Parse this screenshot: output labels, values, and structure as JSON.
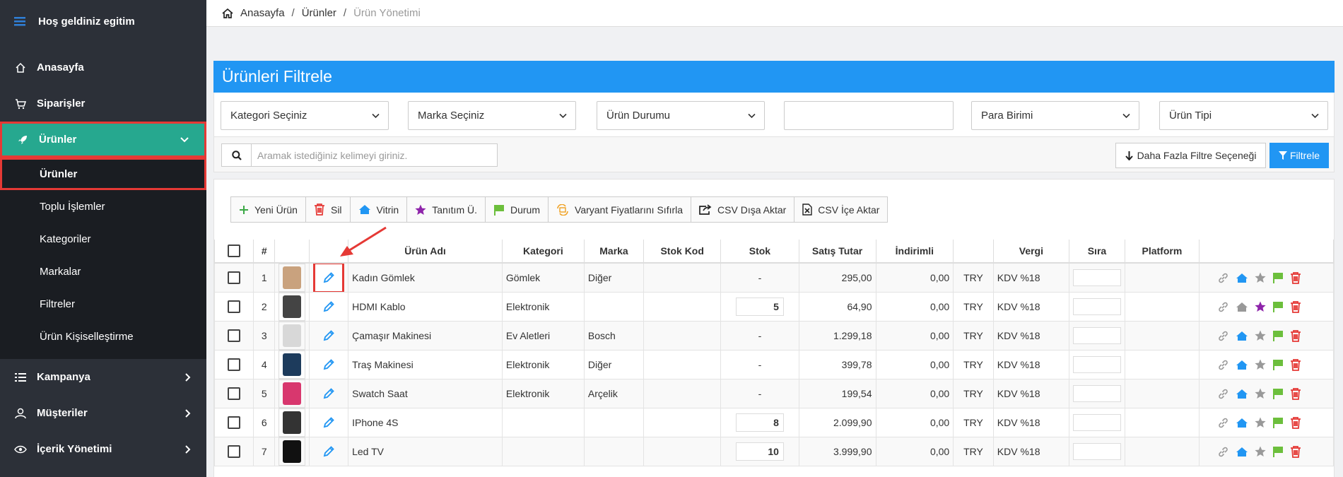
{
  "sidebar": {
    "title": "Hoş geldiniz egitim",
    "items": [
      {
        "label": "Anasayfa",
        "icon": "home-icon"
      },
      {
        "label": "Siparişler",
        "icon": "cart-icon"
      },
      {
        "label": "Ürünler",
        "icon": "rocket-icon",
        "expanded": true
      },
      {
        "label": "Kampanya",
        "icon": "list-icon"
      },
      {
        "label": "Müşteriler",
        "icon": "user-icon"
      },
      {
        "label": "İçerik Yönetimi",
        "icon": "eye-icon"
      }
    ],
    "subitems": [
      "Ürünler",
      "Toplu İşlemler",
      "Kategoriler",
      "Markalar",
      "Filtreler",
      "Ürün Kişiselleştirme"
    ]
  },
  "breadcrumb": {
    "home": "Anasayfa",
    "sep": "/",
    "section": "Ürünler",
    "current": "Ürün Yönetimi"
  },
  "filter": {
    "title": "Ürünleri Filtrele",
    "selects": [
      "Kategori Seçiniz",
      "Marka Seçiniz",
      "Ürün Durumu",
      "",
      "Para Birimi",
      "Ürün Tipi"
    ],
    "search_placeholder": "Aramak istediğiniz kelimeyi giriniz.",
    "more_label": "Daha Fazla Filtre Seçeneği",
    "filter_label": "Filtrele"
  },
  "toolbar": [
    {
      "label": "Yeni Ürün",
      "icon": "plus-icon"
    },
    {
      "label": "Sil",
      "icon": "trash-icon"
    },
    {
      "label": "Vitrin",
      "icon": "home-icon"
    },
    {
      "label": "Tanıtım Ü.",
      "icon": "star-icon"
    },
    {
      "label": "Durum",
      "icon": "flag-icon"
    },
    {
      "label": "Varyant Fiyatlarını Sıfırla",
      "icon": "refresh-money-icon"
    },
    {
      "label": "CSV Dışa Aktar",
      "icon": "export-icon"
    },
    {
      "label": "CSV İçe Aktar",
      "icon": "excel-icon"
    }
  ],
  "table": {
    "headers": [
      "#",
      "Ürün Adı",
      "Kategori",
      "Marka",
      "Stok Kod",
      "Stok",
      "Satış Tutar",
      "İndirimli",
      "Vergi",
      "Sıra",
      "Platform"
    ],
    "rows": [
      {
        "no": "1",
        "name": "Kadın Gömlek",
        "category": "Gömlek",
        "brand": "Diğer",
        "code": "",
        "stock": "-",
        "price": "295,00",
        "discount": "0,00",
        "currency": "TRY",
        "tax": "KDV %18",
        "star_active": false,
        "showcase_active": true,
        "thumb_color": "#c9a27e"
      },
      {
        "no": "2",
        "name": "HDMI Kablo",
        "category": "Elektronik",
        "brand": "",
        "code": "",
        "stock": "5",
        "price": "64,90",
        "discount": "0,00",
        "currency": "TRY",
        "tax": "KDV %18",
        "star_active": true,
        "showcase_active": false,
        "thumb_color": "#444444"
      },
      {
        "no": "3",
        "name": "Çamaşır Makinesi",
        "category": "Ev Aletleri",
        "brand": "Bosch",
        "code": "",
        "stock": "-",
        "price": "1.299,18",
        "discount": "0,00",
        "currency": "TRY",
        "tax": "KDV %18",
        "star_active": false,
        "showcase_active": true,
        "thumb_color": "#d8d8d8"
      },
      {
        "no": "4",
        "name": "Traş Makinesi",
        "category": "Elektronik",
        "brand": "Diğer",
        "code": "",
        "stock": "-",
        "price": "399,78",
        "discount": "0,00",
        "currency": "TRY",
        "tax": "KDV %18",
        "star_active": false,
        "showcase_active": true,
        "thumb_color": "#1d3b5c"
      },
      {
        "no": "5",
        "name": "Swatch Saat",
        "category": "Elektronik",
        "brand": "Arçelik",
        "code": "",
        "stock": "-",
        "price": "199,54",
        "discount": "0,00",
        "currency": "TRY",
        "tax": "KDV %18",
        "star_active": false,
        "showcase_active": true,
        "thumb_color": "#d8376e"
      },
      {
        "no": "6",
        "name": "IPhone 4S",
        "category": "",
        "brand": "",
        "code": "",
        "stock": "8",
        "price": "2.099,90",
        "discount": "0,00",
        "currency": "TRY",
        "tax": "KDV %18",
        "star_active": false,
        "showcase_active": true,
        "thumb_color": "#333333"
      },
      {
        "no": "7",
        "name": "Led TV",
        "category": "",
        "brand": "",
        "code": "",
        "stock": "10",
        "price": "3.999,90",
        "discount": "0,00",
        "currency": "TRY",
        "tax": "KDV %18",
        "star_active": false,
        "showcase_active": true,
        "thumb_color": "#111111"
      }
    ]
  },
  "colors": {
    "sidebar_bg": "#2c3038",
    "active_green": "#26a88f",
    "primary_blue": "#2196f3",
    "highlight_red": "#e53935",
    "flag_green": "#6cbf3c",
    "star_purple": "#8e24aa"
  }
}
